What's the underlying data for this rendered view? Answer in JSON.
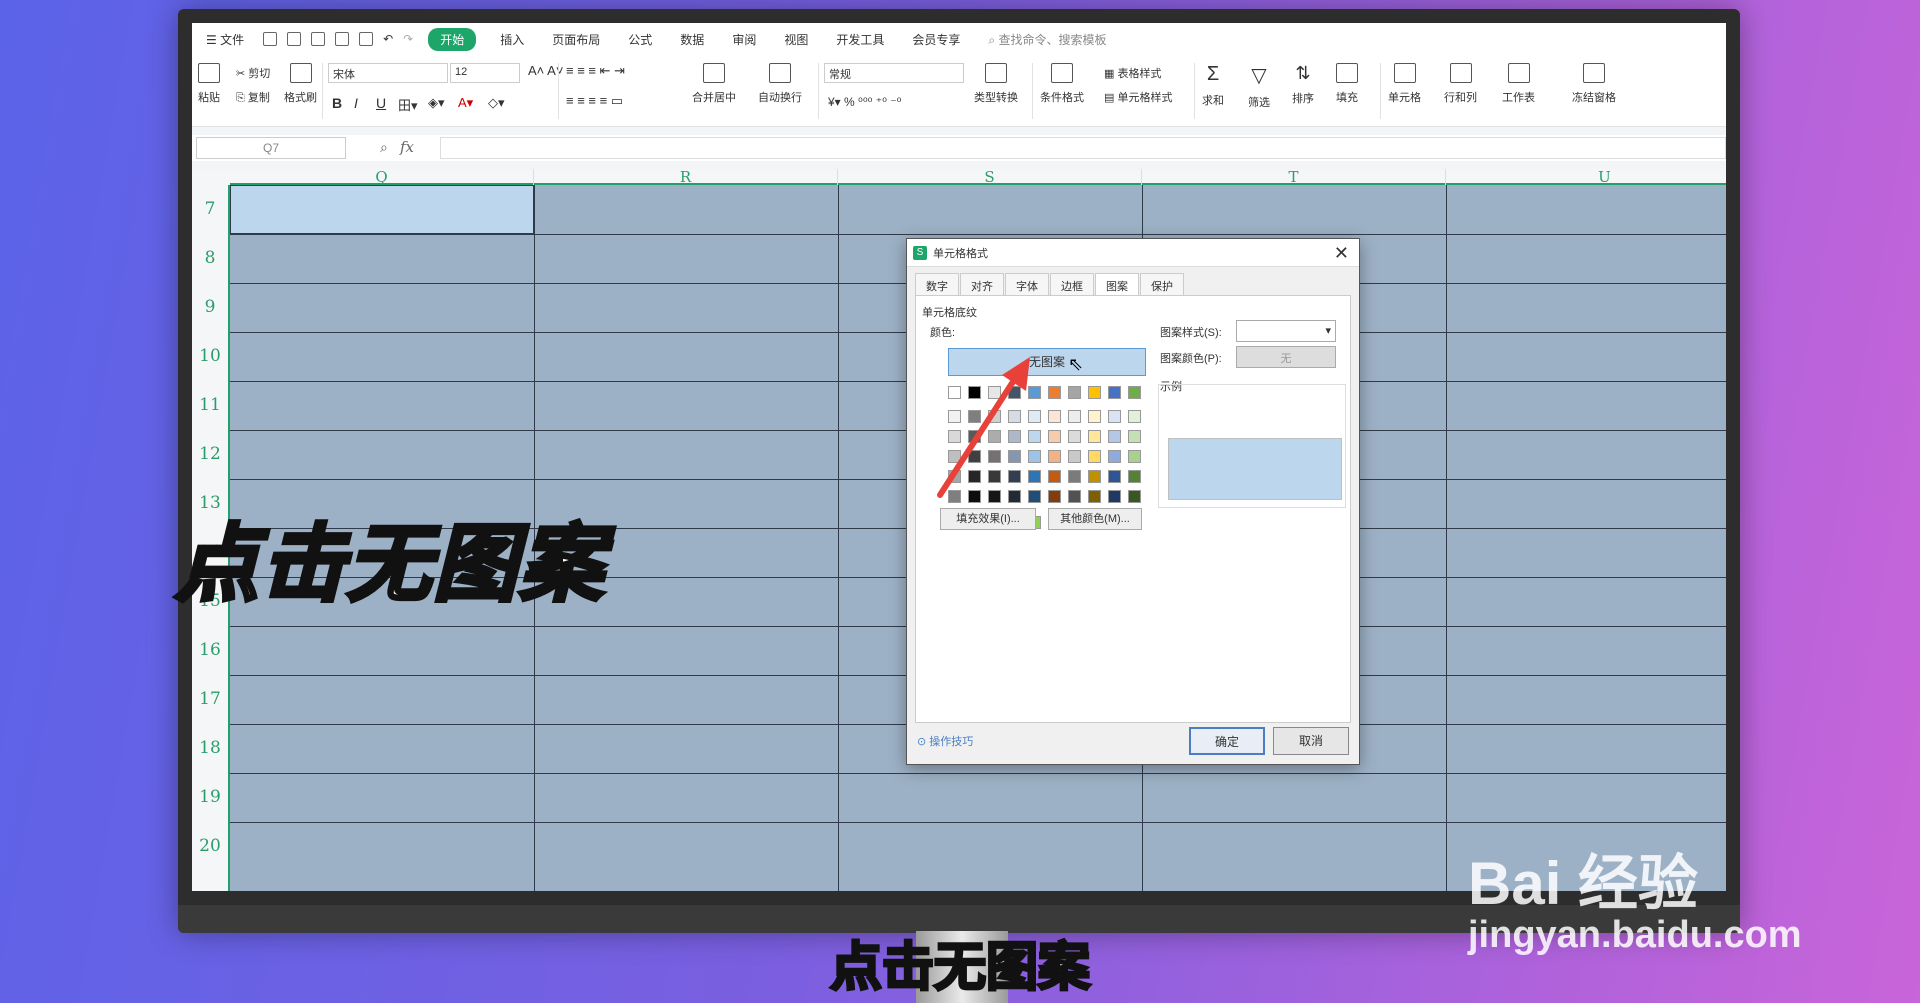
{
  "menu": {
    "file": "文件",
    "items": [
      "开始",
      "插入",
      "页面布局",
      "公式",
      "数据",
      "审阅",
      "视图",
      "开发工具",
      "会员专享"
    ],
    "search": "查找命令、搜索模板"
  },
  "ribbon": {
    "paste": "粘贴",
    "cut": "剪切",
    "copy": "复制",
    "format_painter": "格式刷",
    "font_name": "宋体",
    "font_size": "12",
    "merge": "合并居中",
    "wrap": "自动换行",
    "number_format": "常规",
    "type_convert": "类型转换",
    "cond_format": "条件格式",
    "table_style": "表格样式",
    "cell_style": "单元格样式",
    "sum": "求和",
    "filter": "筛选",
    "sort": "排序",
    "fill": "填充",
    "cell": "单元格",
    "rowcol": "行和列",
    "sheet": "工作表",
    "freeze": "冻结窗格"
  },
  "formula": {
    "name_box": "Q7",
    "fx": "fx"
  },
  "columns": [
    "Q",
    "R",
    "S",
    "T",
    "U"
  ],
  "rows": [
    "7",
    "8",
    "9",
    "10",
    "11",
    "12",
    "13",
    "14",
    "15",
    "16",
    "17",
    "18",
    "19",
    "20"
  ],
  "dialog": {
    "title": "单元格格式",
    "tabs": [
      "数字",
      "对齐",
      "字体",
      "边框",
      "图案",
      "保护"
    ],
    "section": "单元格底纹",
    "color_label": "颜色:",
    "no_pattern": "无图案",
    "fill_effects": "填充效果(I)...",
    "more_colors": "其他颜色(M)...",
    "pattern_style_label": "图案样式(S):",
    "pattern_color_label": "图案颜色(P):",
    "pattern_color_value": "无",
    "sample_label": "示例",
    "tips": "操作技巧",
    "ok": "确定",
    "cancel": "取消",
    "sample_color": "#bcd6ee"
  },
  "overlay": {
    "caption_big": "点击无图案",
    "caption_sub": "点击无图案",
    "watermark_brand": "Bai  经验",
    "watermark_url": "jingyan.baidu.com"
  },
  "colors": {
    "accent": "#1ea66a",
    "cell_bg": "#9db1c6",
    "selected": "#bcd6ee"
  }
}
